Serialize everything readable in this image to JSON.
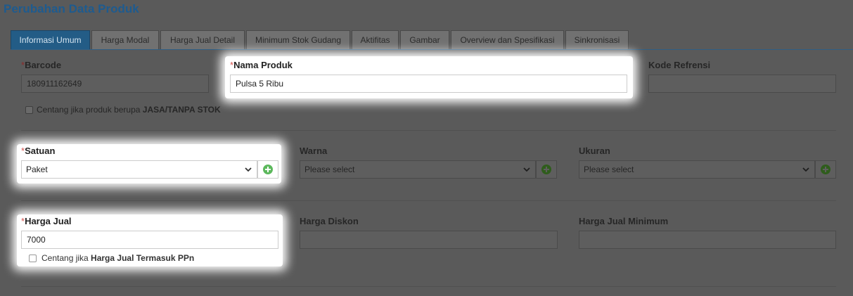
{
  "page_title": "Perubahan Data Produk",
  "tabs": [
    {
      "label": "Informasi Umum",
      "active": true
    },
    {
      "label": "Harga Modal",
      "active": false
    },
    {
      "label": "Harga Jual Detail",
      "active": false
    },
    {
      "label": "Minimum Stok Gudang",
      "active": false
    },
    {
      "label": "Aktifitas",
      "active": false
    },
    {
      "label": "Gambar",
      "active": false
    },
    {
      "label": "Overview dan Spesifikasi",
      "active": false
    },
    {
      "label": "Sinkronisasi",
      "active": false
    }
  ],
  "required_mark": "*",
  "barcode": {
    "label": "Barcode",
    "value": "180911162649"
  },
  "nama_produk": {
    "label": "Nama Produk",
    "value": "Pulsa 5 Ribu"
  },
  "kode_refrensi": {
    "label": "Kode Refrensi",
    "value": ""
  },
  "jasa_checkbox": {
    "text_prefix": "Centang jika produk berupa ",
    "text_bold": "JASA/TANPA STOK",
    "checked": false
  },
  "satuan": {
    "label": "Satuan",
    "selected": "Paket"
  },
  "warna": {
    "label": "Warna",
    "selected": "Please select"
  },
  "ukuran": {
    "label": "Ukuran",
    "selected": "Please select"
  },
  "harga_jual": {
    "label": "Harga Jual",
    "value": "7000"
  },
  "harga_diskon": {
    "label": "Harga Diskon",
    "value": ""
  },
  "harga_jual_minimum": {
    "label": "Harga Jual Minimum",
    "value": ""
  },
  "ppn_checkbox": {
    "text_prefix": "Centang jika ",
    "text_bold": "Harga Jual Termasuk PPn",
    "checked": false
  },
  "icons": {
    "dropdown": "chevron-down-icon",
    "add": "plus-circle-icon"
  },
  "colors": {
    "tab_active": "#235c86",
    "title": "#1e5b8f",
    "add_icon": "#5cb85c",
    "required": "#d9534f"
  }
}
